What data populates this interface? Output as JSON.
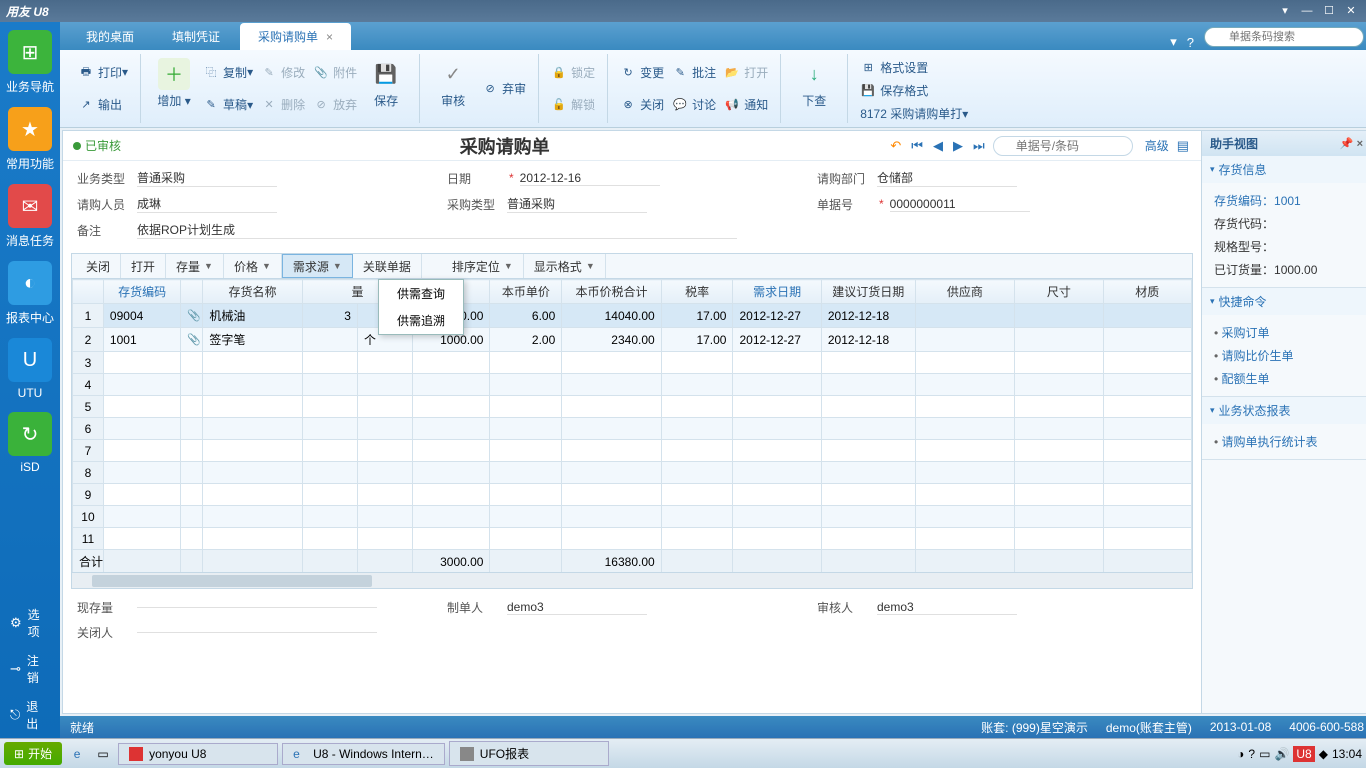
{
  "app": {
    "title": "用友 U8"
  },
  "tabs": {
    "t1": "我的桌面",
    "t2": "填制凭证",
    "t3": "采购请购单"
  },
  "top_search": {
    "placeholder": "单据条码搜索"
  },
  "left_nav": {
    "n1": "业务导航",
    "n2": "常用功能",
    "n3": "消息任务",
    "n4": "报表中心",
    "n5": "UTU",
    "n6": "iSD",
    "o1": "选项",
    "o2": "注销",
    "o3": "退出"
  },
  "ribbon": {
    "print": "打印",
    "output": "输出",
    "add": "增加",
    "copy": "复制",
    "draft": "草稿",
    "modify": "修改",
    "delete": "删除",
    "attach": "附件",
    "abandon": "放弃",
    "save": "保存",
    "audit": "审核",
    "unaudit": "弃审",
    "lock": "锁定",
    "unlock": "解锁",
    "change": "变更",
    "close": "关闭",
    "open": "打开",
    "batch_note": "批注",
    "discuss": "讨论",
    "notify": "通知",
    "push": "下查",
    "format_set": "格式设置",
    "save_format": "保存格式",
    "format_name": "8172 采购请购单打"
  },
  "doc": {
    "status": "已审核",
    "title": "采购请购单",
    "nav_search_ph": "单据号/条码",
    "advanced": "高级",
    "fields": {
      "biz_type_lbl": "业务类型",
      "biz_type": "普通采购",
      "date_lbl": "日期",
      "date": "2012-12-16",
      "dept_lbl": "请购部门",
      "dept": "仓储部",
      "person_lbl": "请购人员",
      "person": "成琳",
      "pur_type_lbl": "采购类型",
      "pur_type": "普通采购",
      "bill_no_lbl": "单据号",
      "bill_no": "0000000011",
      "remark_lbl": "备注",
      "remark": "依据ROP计划生成",
      "stock_lbl": "现存量",
      "maker_lbl": "制单人",
      "maker": "demo3",
      "auditor_lbl": "审核人",
      "auditor": "demo3",
      "closer_lbl": "关闭人"
    },
    "grid_tb": {
      "close": "关闭",
      "open": "打开",
      "stock": "存量",
      "price": "价格",
      "demand": "需求源",
      "rel": "关联单据",
      "sort": "排序定位",
      "disp": "显示格式"
    },
    "dropdown": {
      "d1": "供需查询",
      "d2": "供需追溯"
    },
    "cols": {
      "code": "存货编码",
      "name": "存货名称",
      "partial": "量",
      "qty": "数量",
      "price": "本币单价",
      "amt": "本币价税合计",
      "tax": "税率",
      "need_date": "需求日期",
      "suggest_date": "建议订货日期",
      "supplier": "供应商",
      "size": "尺寸",
      "material": "材质"
    },
    "rows": [
      {
        "code": "09004",
        "name": "机械油",
        "partial": "3",
        "qty": "2000.00",
        "price": "6.00",
        "amt": "14040.00",
        "tax": "17.00",
        "need": "2012-12-27",
        "sug": "2012-12-18"
      },
      {
        "code": "1001",
        "name": "签字笔",
        "unit": "个",
        "qty": "1000.00",
        "price": "2.00",
        "amt": "2340.00",
        "tax": "17.00",
        "need": "2012-12-27",
        "sug": "2012-12-18"
      }
    ],
    "total_lbl": "合计",
    "total_qty": "3000.00",
    "total_amt": "16380.00"
  },
  "right": {
    "title": "助手视图",
    "sec1": "存货信息",
    "inv_code_lbl": "存货编码：",
    "inv_code": "1001",
    "inv_id_lbl": "存货代码：",
    "spec_lbl": "规格型号：",
    "ordered_lbl": "已订货量：",
    "ordered": "1000.00",
    "sec2": "快捷命令",
    "q1": "采购订单",
    "q2": "请购比价生单",
    "q3": "配额生单",
    "sec3": "业务状态报表",
    "r1": "请购单执行统计表"
  },
  "status_bar": {
    "ready": "就绪",
    "acct": "账套: (999)星空演示",
    "user": "demo(账套主管)",
    "date": "2013-01-08",
    "tel": "4006-600-588"
  },
  "taskbar": {
    "start": "开始",
    "t1": "yonyou U8",
    "t2": "U8 - Windows Intern…",
    "t3": "UFO报表",
    "time": "13:04"
  }
}
